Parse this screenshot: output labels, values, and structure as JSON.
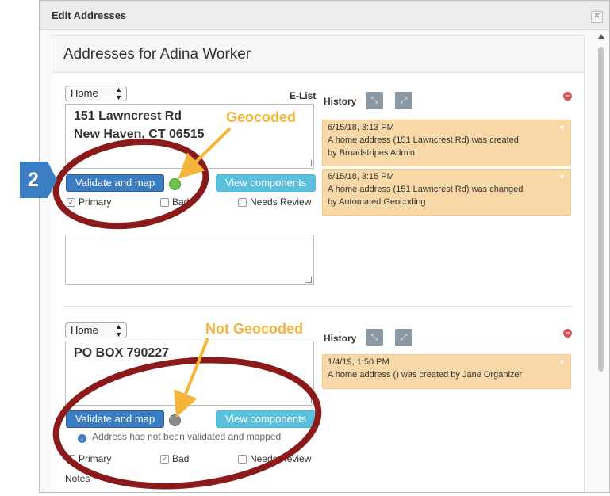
{
  "window": {
    "title": "Edit Addresses",
    "close_glyph": "✕"
  },
  "panel": {
    "heading": "Addresses for Adina Worker"
  },
  "addresses": [
    {
      "type": "Home",
      "elist_label": "E-List",
      "lines": [
        "151 Lawncrest Rd",
        "New Haven, CT 06515"
      ],
      "validate_label": "Validate and map",
      "view_label": "View components",
      "geocode_status": "geocoded",
      "geocode_color": "#6cc24a",
      "primary_label": "Primary",
      "primary_checked": true,
      "bad_label": "Bad",
      "bad_checked": false,
      "review_label": "Needs Review",
      "review_checked": false,
      "history_label": "History",
      "history": [
        {
          "time": "6/15/18, 3:13 PM",
          "line1": "A home address (151 Lawncrest Rd) was created",
          "line2": "by Broadstripes Admin"
        },
        {
          "time": "6/15/18, 3:15 PM",
          "line1": "A home address (151 Lawncrest Rd) was changed",
          "line2": "by Automated Geocoding"
        }
      ]
    },
    {
      "type": "Home",
      "lines": [
        "PO BOX 790227"
      ],
      "validate_label": "Validate and map",
      "view_label": "View components",
      "geocode_status": "not geocoded",
      "geocode_color": "#8a8a8a",
      "info_text": "Address has not been validated and mapped",
      "primary_label": "Primary",
      "primary_checked": false,
      "bad_label": "Bad",
      "bad_checked": true,
      "review_label": "Needs Review",
      "review_checked": false,
      "notes_label": "Notes",
      "history_label": "History",
      "history": [
        {
          "time": "1/4/19, 1:50 PM",
          "line1": "A home address () was created by Jane Organizer"
        }
      ]
    }
  ],
  "annotations": {
    "geocoded_label": "Geocoded",
    "not_geocoded_label": "Not Geocoded",
    "step_number": "2",
    "arrow_color": "#f3b53a",
    "circle_color": "#8b1a1a"
  },
  "icons": {
    "expand": "expand-icon",
    "collapse": "collapse-icon",
    "remove": "remove-circle-icon",
    "chevron": "chevron-down-icon",
    "info": "info-icon"
  }
}
